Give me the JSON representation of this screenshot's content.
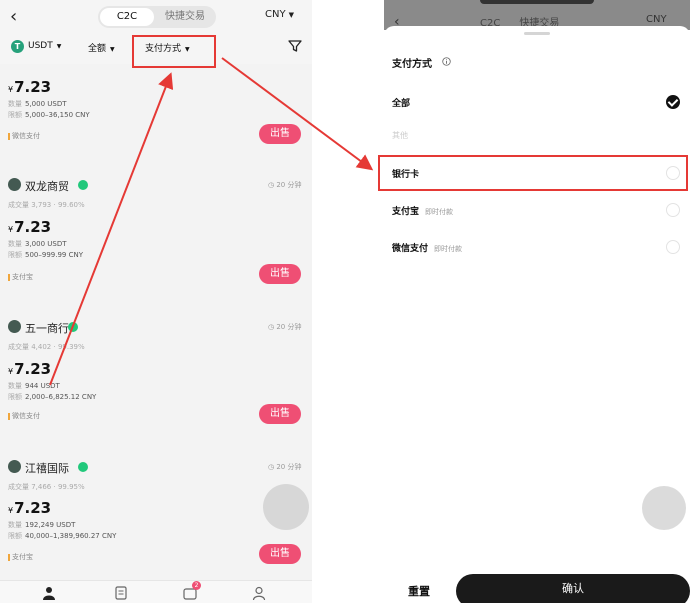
{
  "left": {
    "header": {
      "tab_c2c": "C2C",
      "tab_quick": "快捷交易",
      "currency": "CNY"
    },
    "filters": {
      "coin": "USDT",
      "coin_letter": "T",
      "amount": "全额",
      "payment": "支付方式"
    },
    "listings": [
      {
        "name": "",
        "time": "",
        "stats": "",
        "currency_symbol": "¥",
        "price": "7.23",
        "qty_label": "数量",
        "qty": "5,000 USDT",
        "limit_label": "限额",
        "limit": "5,000–36,150 CNY",
        "pay_method": "微信支付",
        "action": "出售"
      },
      {
        "name": "双龙商贸",
        "time": "20 分钟",
        "stats": "成交量 3,793 · 99.60%",
        "currency_symbol": "¥",
        "price": "7.23",
        "qty_label": "数量",
        "qty": "3,000 USDT",
        "limit_label": "限额",
        "limit": "500–999.99 CNY",
        "pay_method": "支付宝",
        "action": "出售"
      },
      {
        "name": "五一商行",
        "time": "20 分钟",
        "stats": "成交量 4,402 · 99.39%",
        "currency_symbol": "¥",
        "price": "7.23",
        "qty_label": "数量",
        "qty": "944 USDT",
        "limit_label": "限额",
        "limit": "2,000–6,825.12 CNY",
        "pay_method": "微信支付",
        "action": "出售"
      },
      {
        "name": "江禧国际",
        "time": "20 分钟",
        "stats": "成交量 7,466 · 99.95%",
        "currency_symbol": "¥",
        "price": "7.23",
        "qty_label": "数量",
        "qty": "192,249 USDT",
        "limit_label": "限额",
        "limit": "40,000–1,389,960.27 CNY",
        "pay_method": "支付宝",
        "action": "出售"
      }
    ],
    "nav_badge": "2"
  },
  "right": {
    "header": {
      "tab_c2c": "C2C",
      "tab_quick": "快捷交易",
      "currency": "CNY"
    },
    "sheet_title": "支付方式",
    "options": [
      {
        "label": "全部",
        "sub": "",
        "selected": true
      },
      {
        "label": "其他",
        "sub": "",
        "selected": false
      },
      {
        "label": "银行卡",
        "sub": "",
        "selected": false
      },
      {
        "label": "支付宝",
        "sub": "即时付款",
        "selected": false
      },
      {
        "label": "微信支付",
        "sub": "即时付款",
        "selected": false
      }
    ],
    "reset": "重置",
    "confirm": "确认"
  },
  "colors": {
    "sell": "#ef4f74",
    "highlight": "#e53935",
    "verified": "#21c87b",
    "tether": "#26a17b"
  }
}
